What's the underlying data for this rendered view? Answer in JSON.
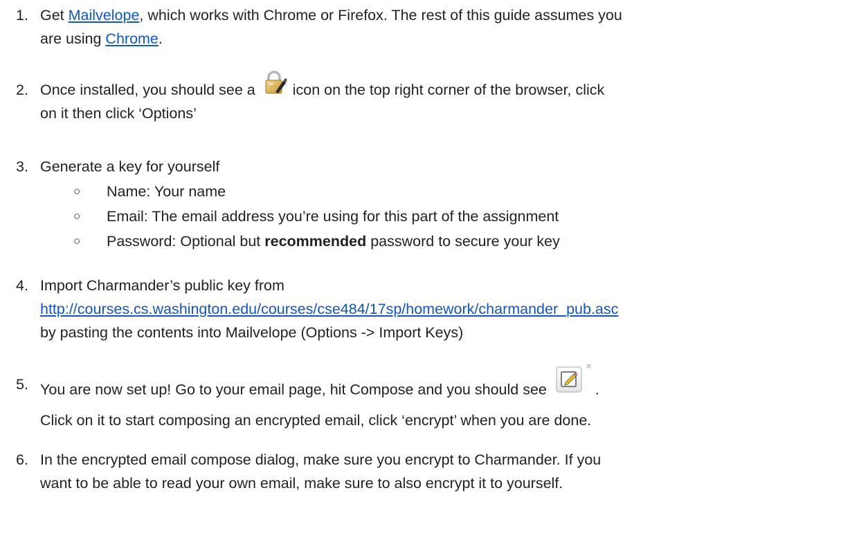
{
  "steps": [
    {
      "number": "1.",
      "pre": "Get ",
      "link1": "Mailvelope",
      "mid": ", which works with Chrome or Firefox. The rest of this guide assumes you",
      "line2_pre": "are using ",
      "link2": "Chrome",
      "line2_post": "."
    },
    {
      "number": "2.",
      "pre": "Once installed, you should see a",
      "post": "icon on the top right corner of the browser, click",
      "line2": "on it then click ‘Options’",
      "icon": "mailvelope-lock-icon"
    },
    {
      "number": "3.",
      "text": "Generate a key for yourself",
      "bullets": [
        {
          "symbol": "○",
          "text": "Name: Your name"
        },
        {
          "symbol": "○",
          "text": "Email: The email address you’re using for this part of the assignment"
        },
        {
          "symbol": "○",
          "pre": "Password: Optional but ",
          "bold": "recommended",
          "post": " password to secure your key"
        }
      ]
    },
    {
      "number": "4.",
      "text": "Import Charmander’s public key from",
      "link": "http://courses.cs.washington.edu/courses/cse484/17sp/homework/charmander_pub.asc",
      "line3": "by pasting the contents into Mailvelope (Options -> Import Keys)"
    },
    {
      "number": "5.",
      "pre": "You are now set up! Go to your email page, hit Compose and you should see",
      "post": ".",
      "line2": "Click on it to start composing an encrypted email, click ‘encrypt’ when you are done.",
      "icon": "compose-encrypted-icon"
    },
    {
      "number": "6.",
      "line1": "In the encrypted email compose dialog, make sure you encrypt to Charmander. If you",
      "line2": "want to be able to read your own email, make sure to also encrypt it to yourself."
    }
  ],
  "colors": {
    "text": "#222222",
    "link": "#1155cc"
  }
}
